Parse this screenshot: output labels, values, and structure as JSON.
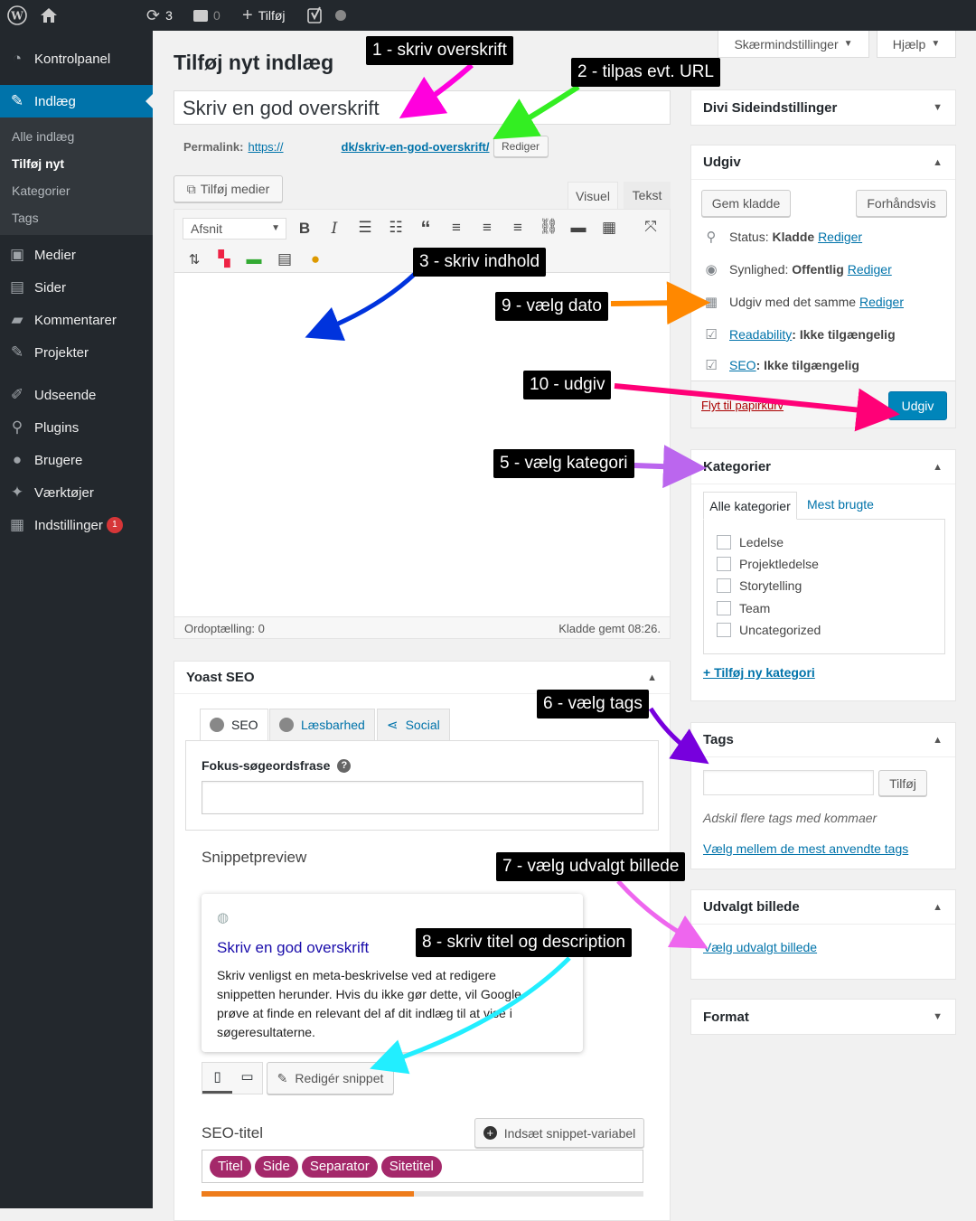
{
  "adminbar": {
    "updates": "3",
    "comments": "0",
    "new_label": "Tilføj"
  },
  "sidebar": {
    "items": [
      {
        "label": "Kontrolpanel",
        "icon": "dashboard-icon"
      },
      {
        "label": "Indlæg",
        "icon": "pin-icon"
      },
      {
        "label": "Medier",
        "icon": "media-icon"
      },
      {
        "label": "Sider",
        "icon": "page-icon"
      },
      {
        "label": "Kommentarer",
        "icon": "comment-icon"
      },
      {
        "label": "Projekter",
        "icon": "pin-icon"
      },
      {
        "label": "Udseende",
        "icon": "brush-icon"
      },
      {
        "label": "Plugins",
        "icon": "plug-icon"
      },
      {
        "label": "Brugere",
        "icon": "user-icon"
      },
      {
        "label": "Værktøjer",
        "icon": "wrench-icon"
      },
      {
        "label": "Indstillinger",
        "icon": "settings-icon",
        "badge": "1"
      }
    ],
    "submenu": [
      "Alle indlæg",
      "Tilføj nyt",
      "Kategorier",
      "Tags"
    ]
  },
  "screen_options": {
    "label": "Skærmindstillinger",
    "help": "Hjælp"
  },
  "page_title": "Tilføj nyt indlæg",
  "title_value": "Skriv en god overskrift",
  "permalink": {
    "label": "Permalink:",
    "url_start": "https://",
    "url_end": "dk/skriv-en-god-overskrift/",
    "edit": "Rediger"
  },
  "editor": {
    "add_media": "Tilføj medier",
    "tab_visual": "Visuel",
    "tab_text": "Tekst",
    "format": "Afsnit",
    "word_count": "Ordoptælling: 0",
    "draft_saved": "Kladde gemt 08:26."
  },
  "yoast": {
    "title": "Yoast SEO",
    "tabs": [
      "SEO",
      "Læsbarhed",
      "Social"
    ],
    "focus_label": "Fokus-søgeordsfrase",
    "snippet_heading": "Snippetpreview",
    "snippet_title": "Skriv en god overskrift",
    "snippet_desc": "Skriv venligst en meta-beskrivelse ved at redigere snippetten herunder. Hvis du ikke gør dette, vil Google prøve at finde en relevant del af dit indlæg til at vise i søgeresultaterne.",
    "edit_snippet": "Redigér snippet",
    "seo_title_label": "SEO-titel",
    "insert_var": "Indsæt snippet-variabel",
    "pills": [
      "Titel",
      "Side",
      "Separator",
      "Sitetitel"
    ]
  },
  "divi": {
    "title": "Divi Sideindstillinger"
  },
  "publish": {
    "title": "Udgiv",
    "save_draft": "Gem kladde",
    "preview": "Forhåndsvis",
    "status_label": "Status:",
    "status_value": "Kladde",
    "visibility_label": "Synlighed:",
    "visibility_value": "Offentlig",
    "publish_label": "Udgiv med det samme",
    "edit": "Rediger",
    "readability_link": "Readability",
    "readability_value": ": Ikke tilgængelig",
    "seo_link": "SEO",
    "seo_value": ": Ikke tilgængelig",
    "trash": "Flyt til papirkurv",
    "publish_btn": "Udgiv"
  },
  "categories": {
    "title": "Kategorier",
    "tab_all": "Alle kategorier",
    "tab_popular": "Mest brugte",
    "items": [
      "Ledelse",
      "Projektledelse",
      "Storytelling",
      "Team",
      "Uncategorized"
    ],
    "add_new": "+ Tilføj ny kategori"
  },
  "tags": {
    "title": "Tags",
    "add": "Tilføj",
    "hint": "Adskil flere tags med kommaer",
    "choose": "Vælg mellem de mest anvendte tags"
  },
  "featured": {
    "title": "Udvalgt billede",
    "link": "Vælg udvalgt billede"
  },
  "format": {
    "title": "Format"
  },
  "annotations": [
    {
      "text": "1 - skriv overskrift",
      "color": "#ff00dd"
    },
    {
      "text": "2 - tilpas evt. URL",
      "color": "#33ee22"
    },
    {
      "text": "3 - skriv indhold",
      "color": "#0033dd"
    },
    {
      "text": "9 - vælg dato",
      "color": "#ff8800"
    },
    {
      "text": "10 - udgiv",
      "color": "#ff0077"
    },
    {
      "text": "5 - vælg kategori",
      "color": "#bb66ee"
    },
    {
      "text": "6 - vælg tags",
      "color": "#7700dd"
    },
    {
      "text": "7 - vælg udvalgt billede",
      "color": "#ee66ee"
    },
    {
      "text": "8 - skriv titel og description",
      "color": "#22eeff"
    }
  ]
}
